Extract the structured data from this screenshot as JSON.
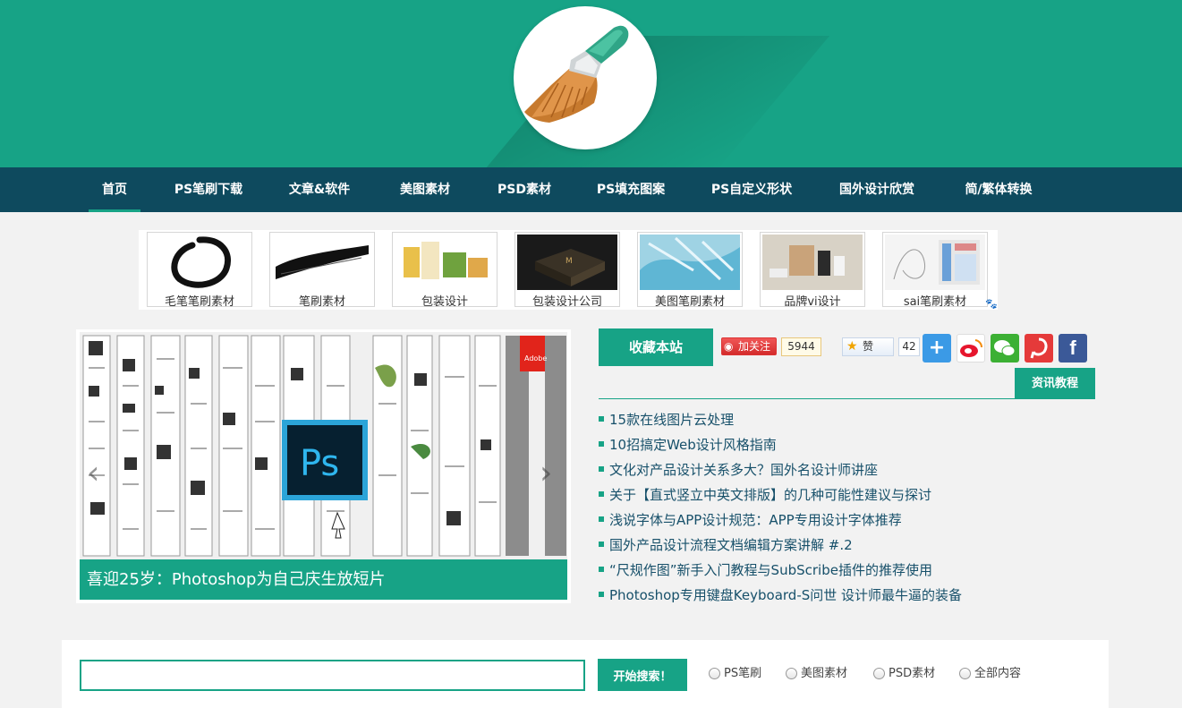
{
  "colors": {
    "brand": "#17a386",
    "nav_bg": "#0e4a5e",
    "link": "#17506a"
  },
  "logo": {
    "icon": "brush-icon"
  },
  "nav": {
    "items": [
      {
        "label": "首页",
        "active": true
      },
      {
        "label": "PS笔刷下载"
      },
      {
        "label": "文章&软件"
      },
      {
        "label": "美图素材"
      },
      {
        "label": "PSD素材"
      },
      {
        "label": "PS填充图案"
      },
      {
        "label": "PS自定义形状"
      },
      {
        "label": "国外设计欣赏"
      },
      {
        "label": "简/繁体转换"
      }
    ]
  },
  "thumbs": [
    {
      "label": "毛笔笔刷素材"
    },
    {
      "label": "笔刷素材"
    },
    {
      "label": "包装设计"
    },
    {
      "label": "包装设计公司"
    },
    {
      "label": "美图笔刷素材"
    },
    {
      "label": "品牌vi设计"
    },
    {
      "label": "sai笔刷素材"
    }
  ],
  "slider": {
    "caption": "喜迎25岁：Photoshop为自己庆生放短片",
    "prev_icon": "chevron-left-icon",
    "next_icon": "chevron-right-icon",
    "center_logo": "Ps"
  },
  "social": {
    "favorite_label": "收藏本站",
    "weibo_follow_label": "加关注",
    "weibo_count": "5944",
    "like_label": "赞",
    "like_count": "42",
    "share_icons": [
      "plus-share-icon",
      "weibo-icon",
      "wechat-icon",
      "tencent-weibo-icon",
      "facebook-icon"
    ]
  },
  "news": {
    "tab_label": "资讯教程",
    "items": [
      "15款在线图片云处理",
      "10招搞定Web设计风格指南",
      "文化对产品设计关系多大？国外名设计师讲座",
      "关于【直式竖立中英文排版】的几种可能性建议与探讨",
      "浅说字体与APP设计规范：APP专用设计字体推荐",
      "国外产品设计流程文档编辑方案讲解 #.2",
      "“尺规作图”新手入门教程与SubScribe插件的推荐使用",
      "Photoshop专用键盘Keyboard-S问世 设计师最牛逼的装备"
    ]
  },
  "search": {
    "value": "",
    "button_label": "开始搜索！",
    "options": [
      "PS笔刷",
      "美图素材",
      "PSD素材",
      "全部内容"
    ]
  }
}
